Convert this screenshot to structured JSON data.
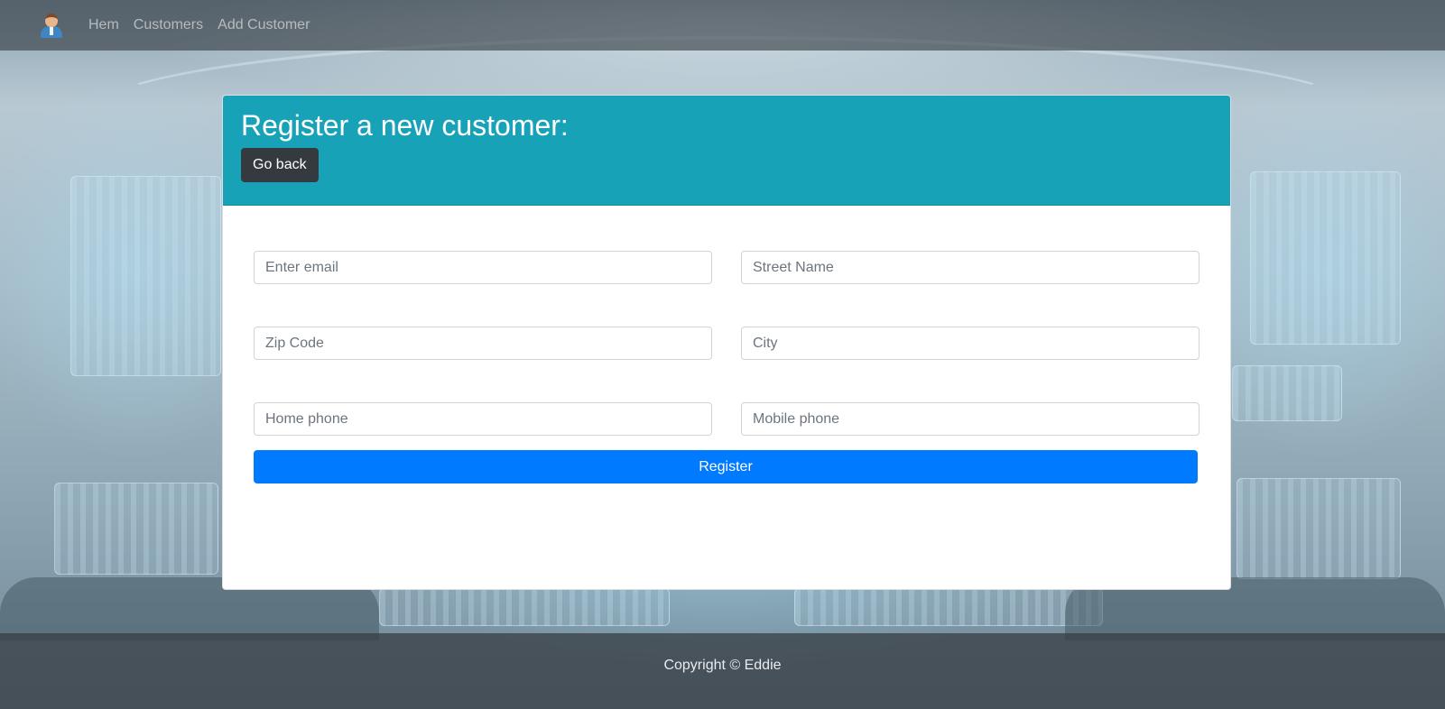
{
  "navbar": {
    "brand_icon": "user-avatar-icon",
    "links": [
      "Hem",
      "Customers",
      "Add Customer"
    ]
  },
  "form": {
    "title": "Register a new customer:",
    "back_label": "Go back",
    "fields": {
      "email": {
        "placeholder": "Enter email",
        "value": ""
      },
      "street": {
        "placeholder": "Street Name",
        "value": ""
      },
      "zip": {
        "placeholder": "Zip Code",
        "value": ""
      },
      "city": {
        "placeholder": "City",
        "value": ""
      },
      "home_phone": {
        "placeholder": "Home phone",
        "value": ""
      },
      "mobile_phone": {
        "placeholder": "Mobile phone",
        "value": ""
      }
    },
    "submit_label": "Register"
  },
  "footer": {
    "text": "Copyright © Eddie"
  },
  "colors": {
    "header": "#17a2b8",
    "back_button": "#343a40",
    "register_button": "#007bff",
    "navbar": "#343a40"
  }
}
